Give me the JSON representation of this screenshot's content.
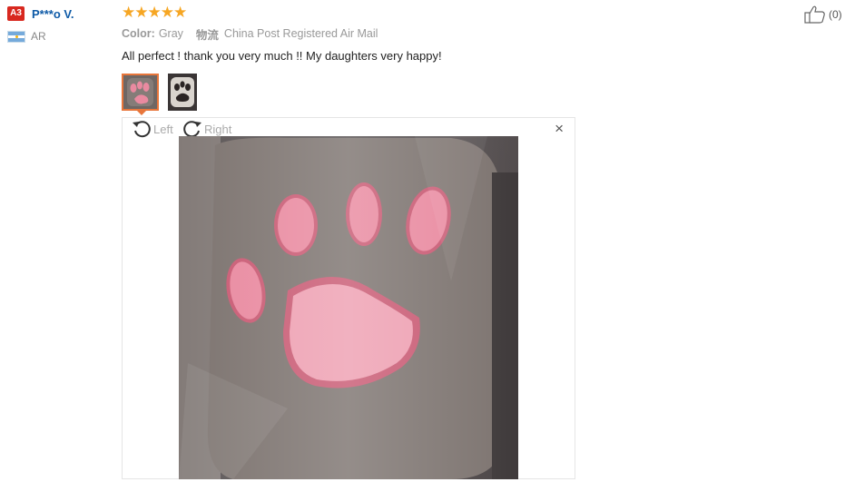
{
  "reviewer": {
    "level_badge": "A3",
    "name": "P***o V.",
    "country_code": "AR"
  },
  "review": {
    "stars": 5,
    "color_label": "Color:",
    "color_value": "Gray",
    "shipping_label": "物流",
    "shipping_value": "China Post Registered Air Mail",
    "text": "All perfect ! thank you very much !! My daughters very happy!"
  },
  "thumbnails": [
    {
      "name": "photo-1",
      "selected": true
    },
    {
      "name": "photo-2",
      "selected": false
    }
  ],
  "viewer": {
    "rotate_left_label": "Left",
    "rotate_right_label": "Right",
    "close_symbol": "×"
  },
  "helpful": {
    "count": "(0)"
  },
  "colors": {
    "badge": "#d8281f",
    "name": "#0e5aa7",
    "star": "#f6a623",
    "thumb_border": "#e8763b",
    "fur": "#7d7470",
    "pad": "#e98aa0"
  }
}
